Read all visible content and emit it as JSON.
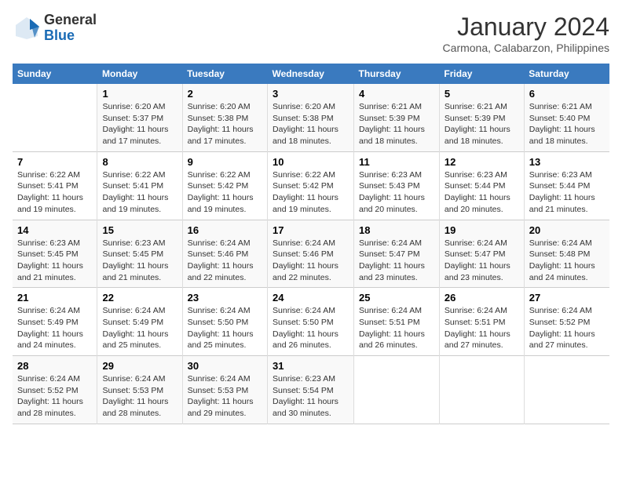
{
  "logo": {
    "line1": "General",
    "line2": "Blue"
  },
  "title": "January 2024",
  "subtitle": "Carmona, Calabarzon, Philippines",
  "days_of_week": [
    "Sunday",
    "Monday",
    "Tuesday",
    "Wednesday",
    "Thursday",
    "Friday",
    "Saturday"
  ],
  "weeks": [
    [
      {
        "day": "",
        "text": ""
      },
      {
        "day": "1",
        "text": "Sunrise: 6:20 AM\nSunset: 5:37 PM\nDaylight: 11 hours\nand 17 minutes."
      },
      {
        "day": "2",
        "text": "Sunrise: 6:20 AM\nSunset: 5:38 PM\nDaylight: 11 hours\nand 17 minutes."
      },
      {
        "day": "3",
        "text": "Sunrise: 6:20 AM\nSunset: 5:38 PM\nDaylight: 11 hours\nand 18 minutes."
      },
      {
        "day": "4",
        "text": "Sunrise: 6:21 AM\nSunset: 5:39 PM\nDaylight: 11 hours\nand 18 minutes."
      },
      {
        "day": "5",
        "text": "Sunrise: 6:21 AM\nSunset: 5:39 PM\nDaylight: 11 hours\nand 18 minutes."
      },
      {
        "day": "6",
        "text": "Sunrise: 6:21 AM\nSunset: 5:40 PM\nDaylight: 11 hours\nand 18 minutes."
      }
    ],
    [
      {
        "day": "7",
        "text": "Sunrise: 6:22 AM\nSunset: 5:41 PM\nDaylight: 11 hours\nand 19 minutes."
      },
      {
        "day": "8",
        "text": "Sunrise: 6:22 AM\nSunset: 5:41 PM\nDaylight: 11 hours\nand 19 minutes."
      },
      {
        "day": "9",
        "text": "Sunrise: 6:22 AM\nSunset: 5:42 PM\nDaylight: 11 hours\nand 19 minutes."
      },
      {
        "day": "10",
        "text": "Sunrise: 6:22 AM\nSunset: 5:42 PM\nDaylight: 11 hours\nand 19 minutes."
      },
      {
        "day": "11",
        "text": "Sunrise: 6:23 AM\nSunset: 5:43 PM\nDaylight: 11 hours\nand 20 minutes."
      },
      {
        "day": "12",
        "text": "Sunrise: 6:23 AM\nSunset: 5:44 PM\nDaylight: 11 hours\nand 20 minutes."
      },
      {
        "day": "13",
        "text": "Sunrise: 6:23 AM\nSunset: 5:44 PM\nDaylight: 11 hours\nand 21 minutes."
      }
    ],
    [
      {
        "day": "14",
        "text": "Sunrise: 6:23 AM\nSunset: 5:45 PM\nDaylight: 11 hours\nand 21 minutes."
      },
      {
        "day": "15",
        "text": "Sunrise: 6:23 AM\nSunset: 5:45 PM\nDaylight: 11 hours\nand 21 minutes."
      },
      {
        "day": "16",
        "text": "Sunrise: 6:24 AM\nSunset: 5:46 PM\nDaylight: 11 hours\nand 22 minutes."
      },
      {
        "day": "17",
        "text": "Sunrise: 6:24 AM\nSunset: 5:46 PM\nDaylight: 11 hours\nand 22 minutes."
      },
      {
        "day": "18",
        "text": "Sunrise: 6:24 AM\nSunset: 5:47 PM\nDaylight: 11 hours\nand 23 minutes."
      },
      {
        "day": "19",
        "text": "Sunrise: 6:24 AM\nSunset: 5:47 PM\nDaylight: 11 hours\nand 23 minutes."
      },
      {
        "day": "20",
        "text": "Sunrise: 6:24 AM\nSunset: 5:48 PM\nDaylight: 11 hours\nand 24 minutes."
      }
    ],
    [
      {
        "day": "21",
        "text": "Sunrise: 6:24 AM\nSunset: 5:49 PM\nDaylight: 11 hours\nand 24 minutes."
      },
      {
        "day": "22",
        "text": "Sunrise: 6:24 AM\nSunset: 5:49 PM\nDaylight: 11 hours\nand 25 minutes."
      },
      {
        "day": "23",
        "text": "Sunrise: 6:24 AM\nSunset: 5:50 PM\nDaylight: 11 hours\nand 25 minutes."
      },
      {
        "day": "24",
        "text": "Sunrise: 6:24 AM\nSunset: 5:50 PM\nDaylight: 11 hours\nand 26 minutes."
      },
      {
        "day": "25",
        "text": "Sunrise: 6:24 AM\nSunset: 5:51 PM\nDaylight: 11 hours\nand 26 minutes."
      },
      {
        "day": "26",
        "text": "Sunrise: 6:24 AM\nSunset: 5:51 PM\nDaylight: 11 hours\nand 27 minutes."
      },
      {
        "day": "27",
        "text": "Sunrise: 6:24 AM\nSunset: 5:52 PM\nDaylight: 11 hours\nand 27 minutes."
      }
    ],
    [
      {
        "day": "28",
        "text": "Sunrise: 6:24 AM\nSunset: 5:52 PM\nDaylight: 11 hours\nand 28 minutes."
      },
      {
        "day": "29",
        "text": "Sunrise: 6:24 AM\nSunset: 5:53 PM\nDaylight: 11 hours\nand 28 minutes."
      },
      {
        "day": "30",
        "text": "Sunrise: 6:24 AM\nSunset: 5:53 PM\nDaylight: 11 hours\nand 29 minutes."
      },
      {
        "day": "31",
        "text": "Sunrise: 6:23 AM\nSunset: 5:54 PM\nDaylight: 11 hours\nand 30 minutes."
      },
      {
        "day": "",
        "text": ""
      },
      {
        "day": "",
        "text": ""
      },
      {
        "day": "",
        "text": ""
      }
    ]
  ]
}
